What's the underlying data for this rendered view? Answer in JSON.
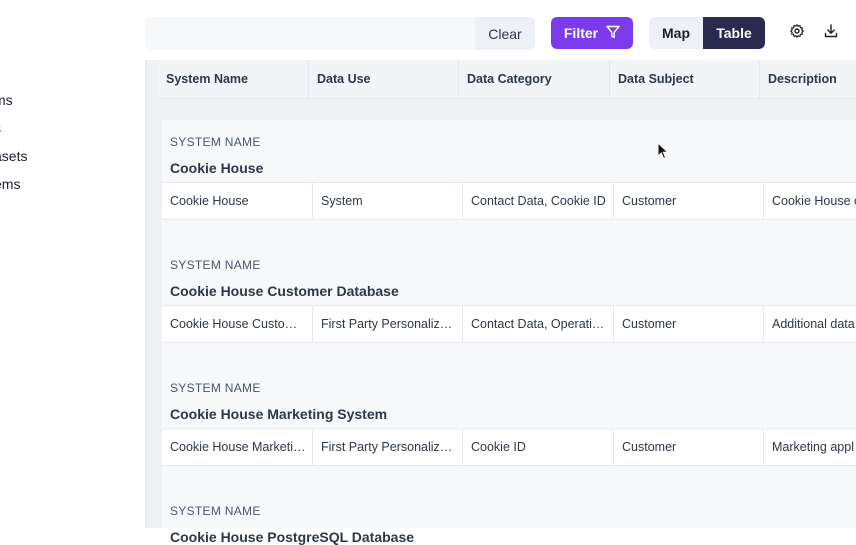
{
  "sidebar": {
    "items": [
      {
        "label": "ms"
      },
      {
        "label": "s"
      },
      {
        "label": "asets"
      },
      {
        "label": "ems"
      }
    ]
  },
  "toolbar": {
    "search_placeholder": "",
    "clear_label": "Clear",
    "filter_label": "Filter",
    "view_toggle": {
      "map_label": "Map",
      "table_label": "Table",
      "selected": "Table"
    },
    "icons": [
      "gear-icon",
      "download-icon",
      "filter-icon"
    ]
  },
  "table": {
    "columns": [
      "System Name",
      "Data Use",
      "Data Category",
      "Data Subject",
      "Description"
    ],
    "groups": [
      {
        "label": "SYSTEM NAME",
        "title": "Cookie House",
        "row": [
          "Cookie House",
          "System",
          "Contact Data, Cookie ID",
          "Customer",
          "Cookie House c"
        ]
      },
      {
        "label": "SYSTEM NAME",
        "title": "Cookie House Customer Database",
        "row": [
          "Cookie House Customer Database",
          "First Party Personalization",
          "Contact Data, Operations",
          "Customer",
          "Additional data"
        ]
      },
      {
        "label": "SYSTEM NAME",
        "title": "Cookie House Marketing System",
        "row": [
          "Cookie House Marketing System",
          "First Party Personalization",
          "Cookie ID",
          "Customer",
          "Marketing appl"
        ]
      },
      {
        "label": "SYSTEM NAME",
        "title": "Cookie House PostgreSQL Database",
        "row": []
      }
    ]
  },
  "colors": {
    "accent": "#7c3aed",
    "toggle_active": "#2a2a50",
    "table_bg": "#eef0f4"
  }
}
